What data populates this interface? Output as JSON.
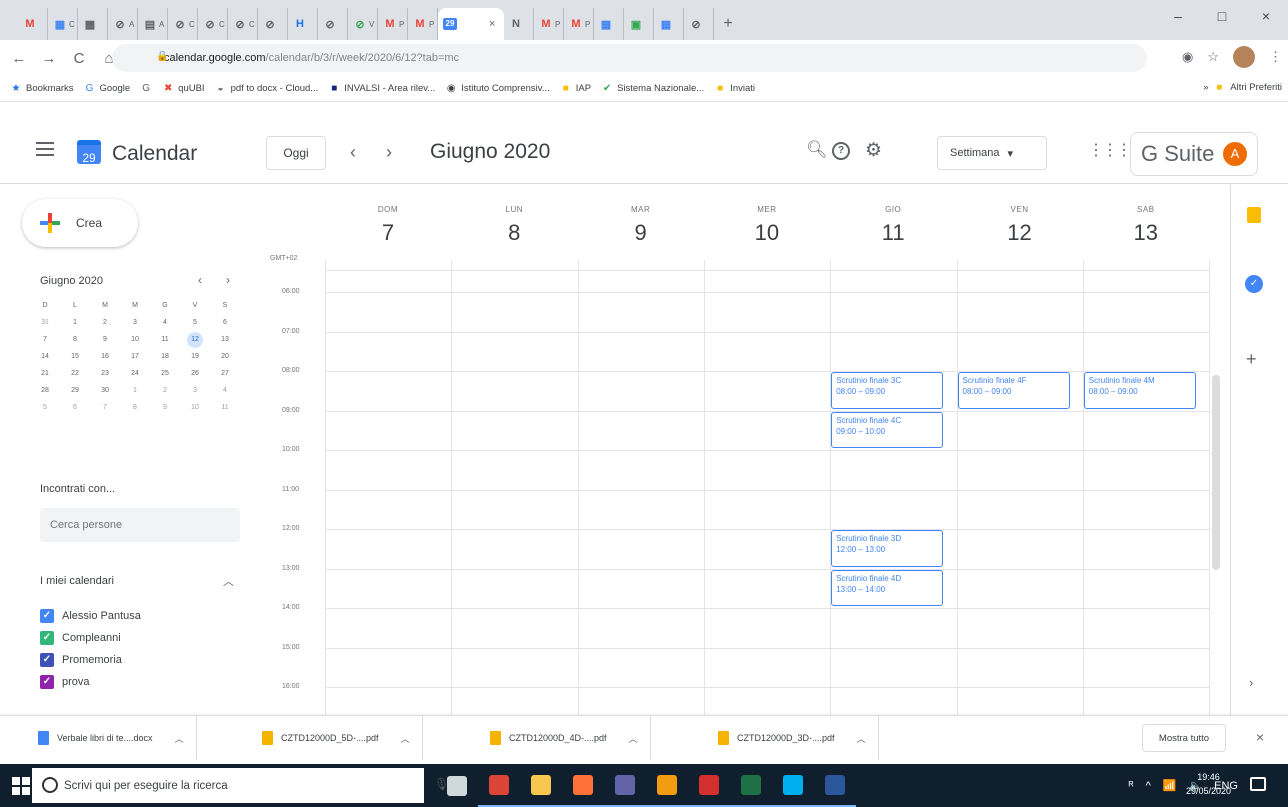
{
  "browser": {
    "tabs": [
      {
        "fav": "M",
        "color": "#ea4335",
        "text": ""
      },
      {
        "fav": "▦",
        "color": "#4285f4",
        "text": "C"
      },
      {
        "fav": "▩",
        "color": "#5f6368",
        "text": ""
      },
      {
        "fav": "⊘",
        "color": "#5f6368",
        "text": "A"
      },
      {
        "fav": "▤",
        "color": "#5f6368",
        "text": "A"
      },
      {
        "fav": "⊘",
        "color": "#5f6368",
        "text": "C"
      },
      {
        "fav": "⊘",
        "color": "#5f6368",
        "text": "C"
      },
      {
        "fav": "⊘",
        "color": "#5f6368",
        "text": "C"
      },
      {
        "fav": "⊘",
        "color": "#5f6368",
        "text": ""
      },
      {
        "fav": "H",
        "color": "#1a73e8",
        "text": ""
      },
      {
        "fav": "⊘",
        "color": "#5f6368",
        "text": ""
      },
      {
        "fav": "⊘",
        "color": "#34a853",
        "text": "V"
      },
      {
        "fav": "M",
        "color": "#ea4335",
        "text": "P"
      },
      {
        "fav": "M",
        "color": "#ea4335",
        "text": "P"
      }
    ],
    "active_tab": {
      "fav": "29",
      "close": "×"
    },
    "tabs_after": [
      {
        "fav": "N",
        "color": "#5f6368",
        "text": ""
      },
      {
        "fav": "M",
        "color": "#ea4335",
        "text": "P"
      },
      {
        "fav": "M",
        "color": "#ea4335",
        "text": "P"
      },
      {
        "fav": "▦",
        "color": "#4285f4",
        "text": ""
      },
      {
        "fav": "▣",
        "color": "#34a853",
        "text": ""
      },
      {
        "fav": "▦",
        "color": "#4285f4",
        "text": ""
      },
      {
        "fav": "⊘",
        "color": "#5f6368",
        "text": ""
      }
    ],
    "new_tab": "+",
    "window": {
      "minimize": "–",
      "maximize": "□",
      "close": "×"
    },
    "nav": {
      "back": "←",
      "forward": "→",
      "reload": "C",
      "home": "⌂"
    },
    "url_host": "calendar.google.com",
    "url_path": "/calendar/b/3/r/week/2020/6/12?tab=mc",
    "bookmarks": [
      {
        "icon": "★",
        "color": "#1a73e8",
        "label": "Bookmarks"
      },
      {
        "icon": "G",
        "color": "#4285f4",
        "label": "Google"
      },
      {
        "icon": "G",
        "color": "#5f6368",
        "label": ""
      },
      {
        "icon": "✖",
        "color": "#ea4335",
        "label": "quUBI"
      },
      {
        "icon": "◒",
        "color": "#5f6368",
        "label": "pdf to docx - Cloud..."
      },
      {
        "icon": "■",
        "color": "#1a237e",
        "label": "INVALSI - Area rilev..."
      },
      {
        "icon": "◉",
        "color": "#3c4043",
        "label": "Istituto Comprensiv..."
      },
      {
        "icon": "■",
        "color": "#fbbc04",
        "label": "IAP"
      },
      {
        "icon": "✔",
        "color": "#34a853",
        "label": "Sistema Nazionale..."
      },
      {
        "icon": "■",
        "color": "#fbbc04",
        "label": "Inviati"
      }
    ],
    "bookmarks_more": "»",
    "other_bookmarks": "Altri Preferiti"
  },
  "calendar": {
    "app_icon_day": "29",
    "app_name": "Calendar",
    "today_label": "Oggi",
    "prev": "‹",
    "next": "›",
    "period": "Giugno 2020",
    "view_label": "Settimana",
    "view_caret": "▾",
    "gsuite_label": "G Suite",
    "avatar_initial": "A",
    "create_label": "Crea",
    "mini_month": "Giugno 2020",
    "mini_weekdays": [
      "D",
      "L",
      "M",
      "M",
      "G",
      "V",
      "S"
    ],
    "mini_weeks": [
      [
        "31",
        "1",
        "2",
        "3",
        "4",
        "5",
        "6"
      ],
      [
        "7",
        "8",
        "9",
        "10",
        "11",
        "12",
        "13"
      ],
      [
        "14",
        "15",
        "16",
        "17",
        "18",
        "19",
        "20"
      ],
      [
        "21",
        "22",
        "23",
        "24",
        "25",
        "26",
        "27"
      ],
      [
        "28",
        "29",
        "30",
        "1",
        "2",
        "3",
        "4"
      ],
      [
        "5",
        "6",
        "7",
        "8",
        "9",
        "10",
        "11"
      ]
    ],
    "meet_title": "Incontrati con...",
    "people_placeholder": "Cerca persone",
    "my_calendars_title": "I miei calendari",
    "my_calendars_toggle": "︿",
    "my_calendars": [
      {
        "name": "Alessio Pantusa",
        "color": "#4285f4"
      },
      {
        "name": "Compleanni",
        "color": "#33b679"
      },
      {
        "name": "Promemoria",
        "color": "#3f51b5"
      },
      {
        "name": "prova",
        "color": "#8e24aa"
      }
    ],
    "timezone": "GMT+02",
    "days": [
      {
        "name": "DOM",
        "num": "7"
      },
      {
        "name": "LUN",
        "num": "8"
      },
      {
        "name": "MAR",
        "num": "9"
      },
      {
        "name": "MER",
        "num": "10"
      },
      {
        "name": "GIO",
        "num": "11"
      },
      {
        "name": "VEN",
        "num": "12"
      },
      {
        "name": "SAB",
        "num": "13"
      }
    ],
    "hours": [
      "06:00",
      "07:00",
      "08:00",
      "09:00",
      "10:00",
      "11:00",
      "12:00",
      "13:00",
      "14:00",
      "15:00",
      "16:00"
    ],
    "events": [
      {
        "title": "Scrutinio finale 3C",
        "time": "08:00 – 09:00",
        "day": 4,
        "start": 8,
        "end": 9
      },
      {
        "title": "Scrutinio finale 4C",
        "time": "09:00 – 10:00",
        "day": 4,
        "start": 9,
        "end": 10
      },
      {
        "title": "Scrutinio finale 3D",
        "time": "12:00 – 13:00",
        "day": 4,
        "start": 12,
        "end": 13
      },
      {
        "title": "Scrutinio finale 4D",
        "time": "13:00 – 14:00",
        "day": 4,
        "start": 13,
        "end": 14
      },
      {
        "title": "Scrutinio finale 4F",
        "time": "08:00 – 09:00",
        "day": 5,
        "start": 8,
        "end": 9
      },
      {
        "title": "Scrutinio finale 4M",
        "time": "08:00 – 09:00",
        "day": 6,
        "start": 8,
        "end": 9
      }
    ],
    "side_panel": {
      "add": "+",
      "expand": "›"
    }
  },
  "downloads": {
    "items": [
      {
        "name": "Verbale libri di te....docx",
        "type": "word"
      },
      {
        "name": "CZTD12000D_5D-....pdf",
        "type": "pdf"
      },
      {
        "name": "CZTD12000D_4D-....pdf",
        "type": "pdf"
      },
      {
        "name": "CZTD12000D_3D-....pdf",
        "type": "pdf"
      }
    ],
    "caret": "︿",
    "show_all": "Mostra tutto",
    "close": "×"
  },
  "taskbar": {
    "search_placeholder": "Scrivi qui per eseguire la ricerca",
    "mic": "🎙",
    "apps": [
      {
        "name": "task-view",
        "color": "#cfd8dc"
      },
      {
        "name": "chrome",
        "color": "#db4437"
      },
      {
        "name": "file-explorer",
        "color": "#f9c74f"
      },
      {
        "name": "firefox",
        "color": "#ff7139"
      },
      {
        "name": "teams",
        "color": "#6264a7"
      },
      {
        "name": "app-orange",
        "color": "#f39c12"
      },
      {
        "name": "acrobat",
        "color": "#d32f2f"
      },
      {
        "name": "excel",
        "color": "#1e7145"
      },
      {
        "name": "skype",
        "color": "#00aff0"
      },
      {
        "name": "word",
        "color": "#2b579a"
      }
    ],
    "tray": [
      "ᴿ",
      "^",
      "📶",
      "🔈",
      "ENG"
    ],
    "time": "19:46",
    "date": "29/05/2020"
  }
}
